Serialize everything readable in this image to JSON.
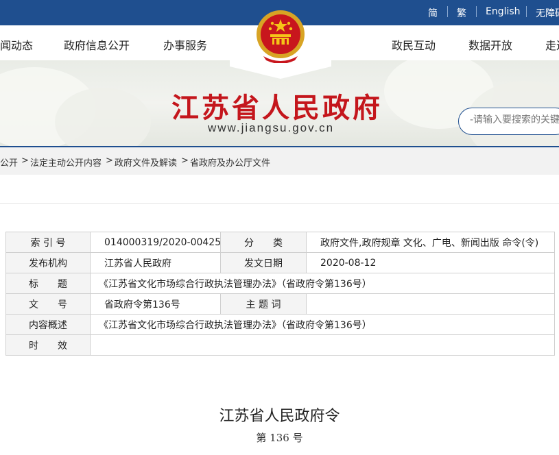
{
  "topbar": {
    "lang_simplified": "简",
    "lang_traditional": "繁",
    "lang_english": "English",
    "accessibility": "无障碍"
  },
  "nav": {
    "news": "闻动态",
    "gov_info": "政府信息公开",
    "services": "办事服务",
    "interaction": "政民互动",
    "open_data": "数据开放",
    "more": "走进"
  },
  "banner": {
    "title": "江苏省人民政府",
    "url": "www.jiangsu.gov.cn",
    "search_placeholder": "-请输入要搜索的关键"
  },
  "breadcrumb": {
    "items": [
      "公开",
      "法定主动公开内容",
      "政府文件及解读",
      "省政府及办公厅文件"
    ],
    "separator": ">"
  },
  "meta": {
    "index_label": "索 引 号",
    "index_value": "014000319/2020-00425",
    "category_label": "分　　类",
    "category_value": "政府文件,政府规章 文化、广电、新闻出版 命令(令)",
    "publisher_label": "发布机构",
    "publisher_value": "江苏省人民政府",
    "date_label": "发文日期",
    "date_value": "2020-08-12",
    "title_label": "标　　题",
    "title_value": "《江苏省文化市场综合行政执法管理办法》（省政府令第136号）",
    "docno_label": "文　　号",
    "docno_value": "省政府令第136号",
    "subject_label": "主 题 词",
    "subject_value": "",
    "summary_label": "内容概述",
    "summary_value": "《江苏省文化市场综合行政执法管理办法》（省政府令第136号）",
    "validity_label": "时　　效",
    "validity_value": ""
  },
  "document": {
    "heading": "江苏省人民政府令",
    "number": "第 136 号"
  },
  "colors": {
    "brand_blue": "#1f4f8f",
    "title_red": "#c4161c"
  }
}
